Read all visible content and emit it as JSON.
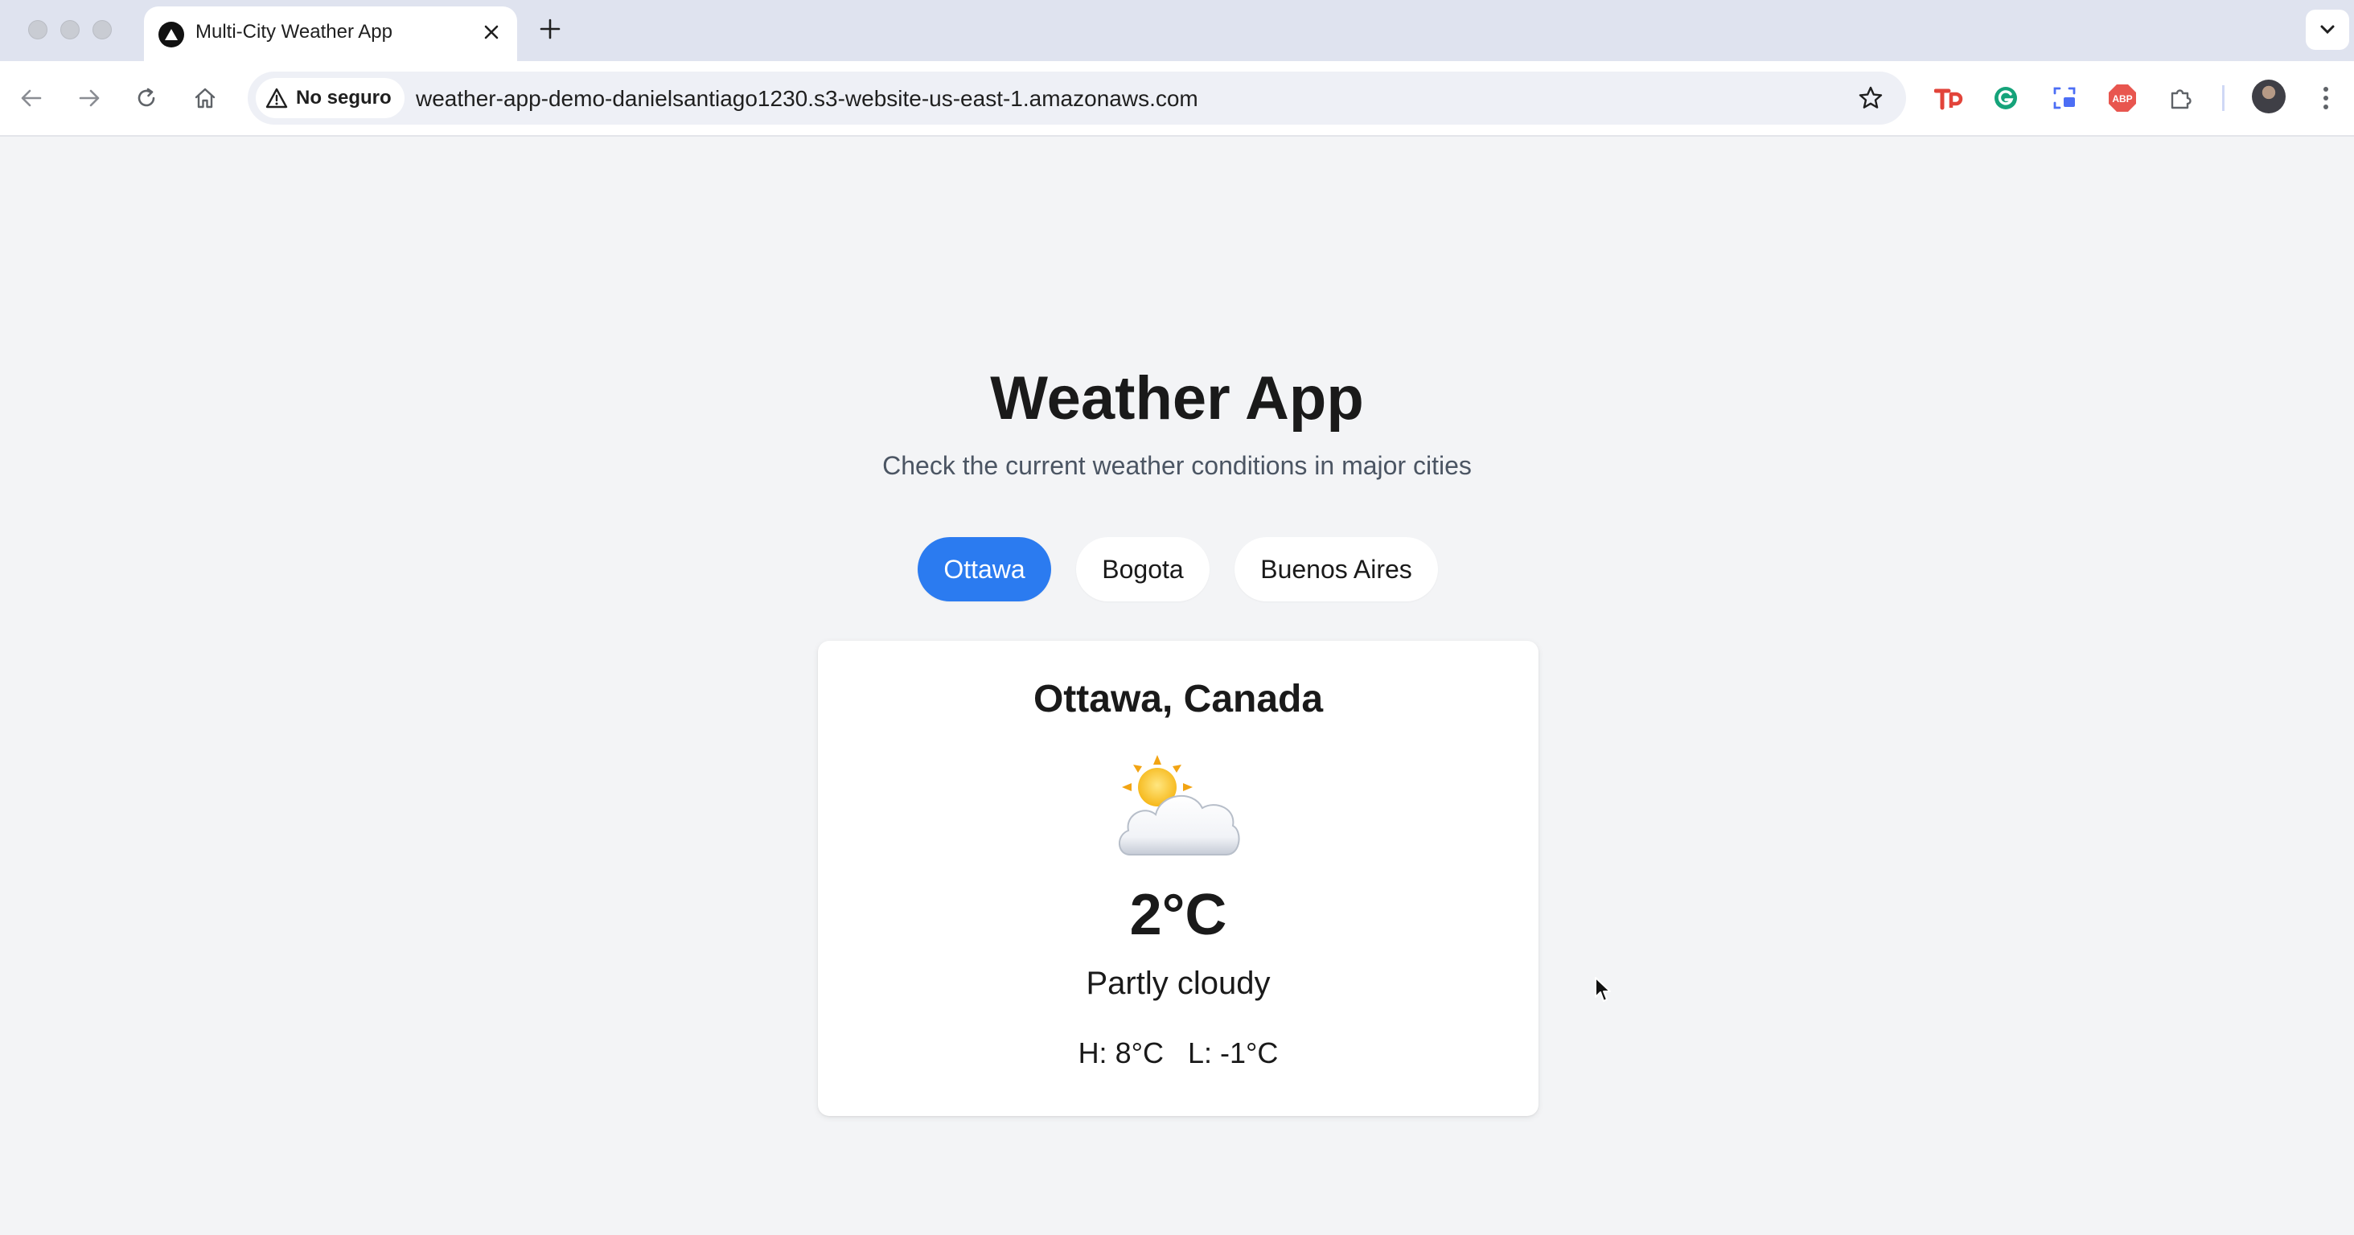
{
  "browser": {
    "tab_title": "Multi-City Weather App",
    "security_label": "No seguro",
    "url": "weather-app-demo-danielsantiago1230.s3-website-us-east-1.amazonaws.com",
    "icons": [
      "back-icon",
      "forward-icon",
      "reload-icon",
      "home-icon",
      "warning-icon",
      "bookmark-star-icon",
      "extension-tp-icon",
      "grammarly-icon",
      "screen-capture-icon",
      "adblock-plus-icon",
      "extensions-puzzle-icon",
      "profile-avatar",
      "more-menu-icon"
    ]
  },
  "app": {
    "title": "Weather App",
    "subtitle": "Check the current weather conditions in major cities",
    "accent_color": "#2b7bf0",
    "cities": [
      {
        "label": "Ottawa",
        "selected": true
      },
      {
        "label": "Bogota",
        "selected": false
      },
      {
        "label": "Buenos Aires",
        "selected": false
      }
    ],
    "weather": {
      "location": "Ottawa, Canada",
      "icon": "sun-behind-cloud-icon",
      "temperature": "2°C",
      "condition": "Partly cloudy",
      "high": "H: 8°C",
      "low": "L: -1°C"
    }
  }
}
